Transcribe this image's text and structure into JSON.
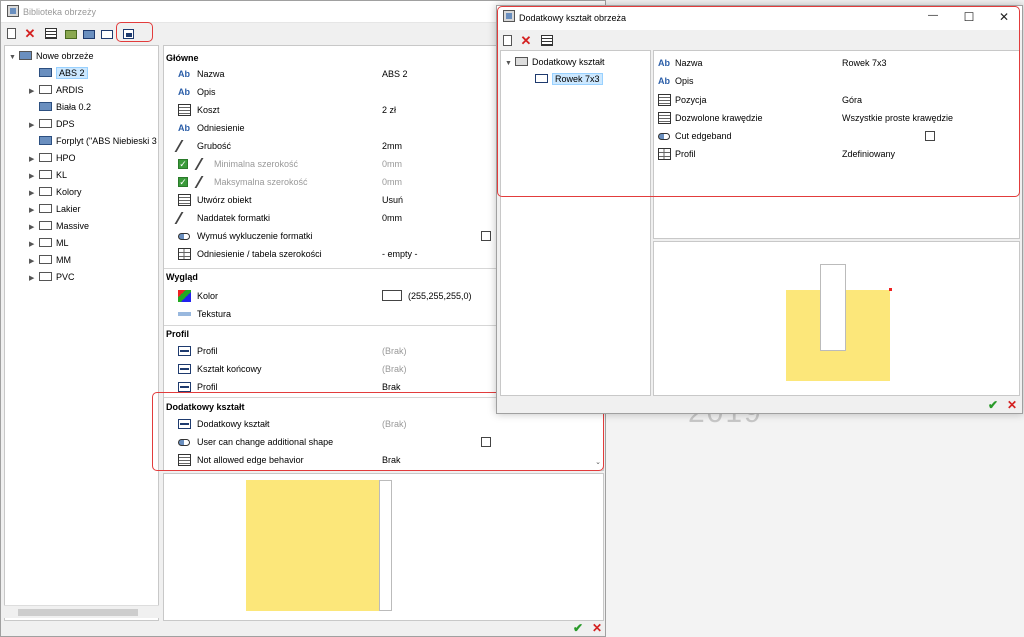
{
  "background_text": "2019",
  "main_window": {
    "title": "Biblioteka obrzeży",
    "tree": {
      "root": "Nowe obrzeże",
      "items": [
        "ABS 2",
        "ARDIS",
        "Biała 0.2",
        "DPS",
        "Forplyt (\"ABS Niebieski 3",
        "HPO",
        "KL",
        "Kolory",
        "Lakier",
        "Massive",
        "ML",
        "MM",
        "PVC"
      ]
    },
    "sections": {
      "main": "Główne",
      "look": "Wygląd",
      "profile": "Profil",
      "additional": "Dodatkowy kształt"
    },
    "main_rows": [
      {
        "label": "Nazwa",
        "value": "ABS 2"
      },
      {
        "label": "Opis",
        "value": ""
      },
      {
        "label": "Koszt",
        "value": "2 zł"
      },
      {
        "label": "Odniesienie",
        "value": ""
      },
      {
        "label": "Grubość",
        "value": "2mm"
      },
      {
        "label": "Minimalna szerokość",
        "value": "0mm"
      },
      {
        "label": "Maksymalna szerokość",
        "value": "0mm"
      },
      {
        "label": "Utwórz obiekt",
        "value": "Usuń"
      },
      {
        "label": "Naddatek formatki",
        "value": "0mm"
      },
      {
        "label": "Wymuś wykluczenie formatki",
        "value": ""
      },
      {
        "label": "Odniesienie / tabela szerokości",
        "value": "- empty -"
      }
    ],
    "look_rows": [
      {
        "label": "Kolor",
        "value": "(255,255,255,0)"
      },
      {
        "label": "Tekstura",
        "value": ""
      }
    ],
    "profile_rows": [
      {
        "label": "Profil",
        "value": "(Brak)"
      },
      {
        "label": "Kształt końcowy",
        "value": "(Brak)"
      },
      {
        "label": "Profil",
        "value": "Brak"
      }
    ],
    "additional_rows": [
      {
        "label": "Dodatkowy kształt",
        "value": "(Brak)"
      },
      {
        "label": "User can change additional shape",
        "value": ""
      },
      {
        "label": "Not allowed edge behavior",
        "value": "Brak"
      }
    ],
    "ok_glyph": "✔",
    "cancel_glyph": "✕"
  },
  "shape_window": {
    "title": "Dodatkowy kształt obrzeża",
    "tree": {
      "root": "Dodatkowy kształt",
      "child": "Rowek 7x3"
    },
    "rows": [
      {
        "label": "Nazwa",
        "value": "Rowek 7x3"
      },
      {
        "label": "Opis",
        "value": ""
      },
      {
        "label": "Pozycja",
        "value": "Góra"
      },
      {
        "label": "Dozwolone krawędzie",
        "value": "Wszystkie proste krawędzie"
      },
      {
        "label": "Cut edgeband",
        "value": ""
      },
      {
        "label": "Profil",
        "value": "Zdefiniowany"
      }
    ],
    "minimize_glyph": "—",
    "maximize_glyph": "☐",
    "close_glyph": "✕",
    "ok_glyph": "✔",
    "cancel_glyph": "✕"
  },
  "colors": {
    "highlight": "#e23c3c",
    "preview_fill": "#fce77a",
    "selection": "#cce8ff"
  }
}
